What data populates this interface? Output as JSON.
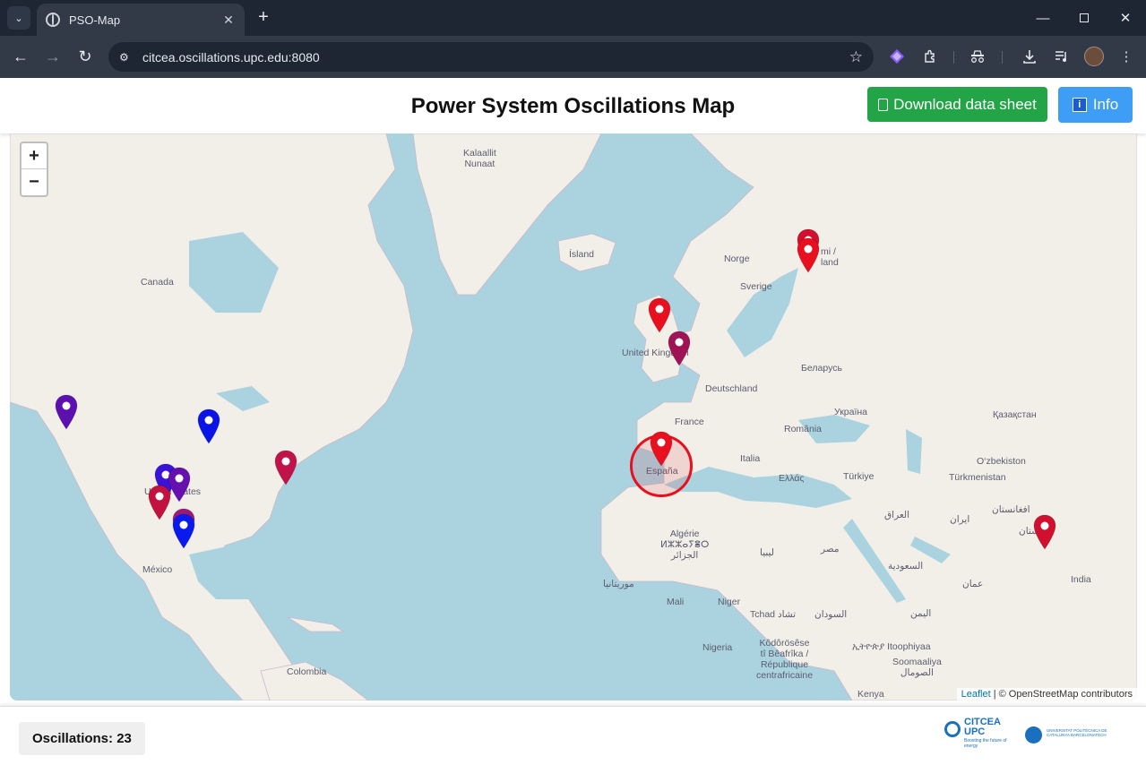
{
  "browser": {
    "tab_title": "PSO-Map",
    "url": "citcea.oscillations.upc.edu:8080",
    "new_tab": "+",
    "close_tab": "✕"
  },
  "header": {
    "title": "Power System Oscillations Map",
    "download_label": "Download data sheet",
    "info_label": "Info",
    "info_icon_glyph": "i"
  },
  "map": {
    "zoom_in": "+",
    "zoom_out": "−",
    "attribution_link": "Leaflet",
    "attribution_text": " | © OpenStreetMap contributors",
    "labels": {
      "greenland_1": "Kalaallit",
      "greenland_2": "Nunaat",
      "island": "Ísland",
      "canada": "Canada",
      "norge": "Norge",
      "sverige": "Sverige",
      "suomi_1": "mi /",
      "suomi_2": "land",
      "uk": "United Kingdom",
      "belarus": "Беларусь",
      "deutschland": "Deutschland",
      "ukraina": "Україна",
      "france": "France",
      "kazakhstan": "Қазақстан",
      "romania": "România",
      "espana": "España",
      "italia": "Italia",
      "ozbekiston": "O‘zbekiston",
      "turkmenistan": "Türkmenistan",
      "ellas": "Ελλάς",
      "turkiye": "Türkiye",
      "united_states": "United States",
      "iraq": "العراق",
      "iran": "ایران",
      "afghanistan": "افغانستان",
      "pakistan": "پاکستان",
      "algerie_1": "Algérie",
      "algerie_2": "ⵍⵣⵣⴰⵢⴻⵔ",
      "algerie_3": "الجزائر",
      "libya": "ليبيا",
      "misr": "مصر",
      "saudi": "السعودية",
      "mexico": "México",
      "mauritania": "موريتانيا",
      "oman": "عمان",
      "india": "India",
      "mali": "Mali",
      "niger": "Niger",
      "tchad": "Tchad تشاد",
      "sudan": "السودان",
      "yemen": "اليمن",
      "nigeria": "Nigeria",
      "cote_1": "Kôdôrösêse",
      "cote_2": "tî Bêafrîka /",
      "cote_3": "République",
      "cote_4": "centrafricaine",
      "ethiopia": "ኢትዮጵያ Itoophiyaa",
      "somalia_1": "Soomaaliya",
      "somalia_2": "الصومال",
      "colombia": "Colombia",
      "kenya": "Kenya"
    },
    "markers": [
      {
        "color": "#5e0fb0",
        "icon": "map-pin-icon"
      },
      {
        "color": "#0a14e6",
        "icon": "map-pin-icon"
      },
      {
        "color": "#3a12d8",
        "icon": "map-pin-icon"
      },
      {
        "color": "#6610b0",
        "icon": "map-pin-icon"
      },
      {
        "color": "#c2123f",
        "icon": "map-pin-icon"
      },
      {
        "color": "#9a1a78",
        "icon": "map-pin-icon"
      },
      {
        "color": "#0a1aef",
        "icon": "map-pin-icon"
      },
      {
        "color": "#c2124a",
        "icon": "map-pin-icon"
      },
      {
        "color": "#e8101e",
        "icon": "map-pin-icon"
      },
      {
        "color": "#a01256",
        "icon": "map-pin-icon"
      },
      {
        "color": "#e8101e",
        "icon": "map-pin-icon"
      },
      {
        "color": "#d0102e",
        "icon": "map-pin-icon"
      },
      {
        "color": "#e8101e",
        "icon": "map-pin-icon"
      },
      {
        "color": "#d0102e",
        "icon": "map-pin-icon"
      }
    ]
  },
  "footer": {
    "oscillations_count": "Oscillations: 23",
    "citcea_line1": "CITCEA",
    "citcea_line2": "UPC",
    "citcea_tagline": "Boosting the future of energy",
    "upc_text": "UNIVERSITAT POLITÈCNICA DE CATALUNYA BARCELONATECH"
  },
  "colors": {
    "download_button": "#22a447",
    "info_button": "#3e9ef5",
    "sea": "#aad3df",
    "land": "#f2efe9",
    "highlight": "#e8101e"
  }
}
